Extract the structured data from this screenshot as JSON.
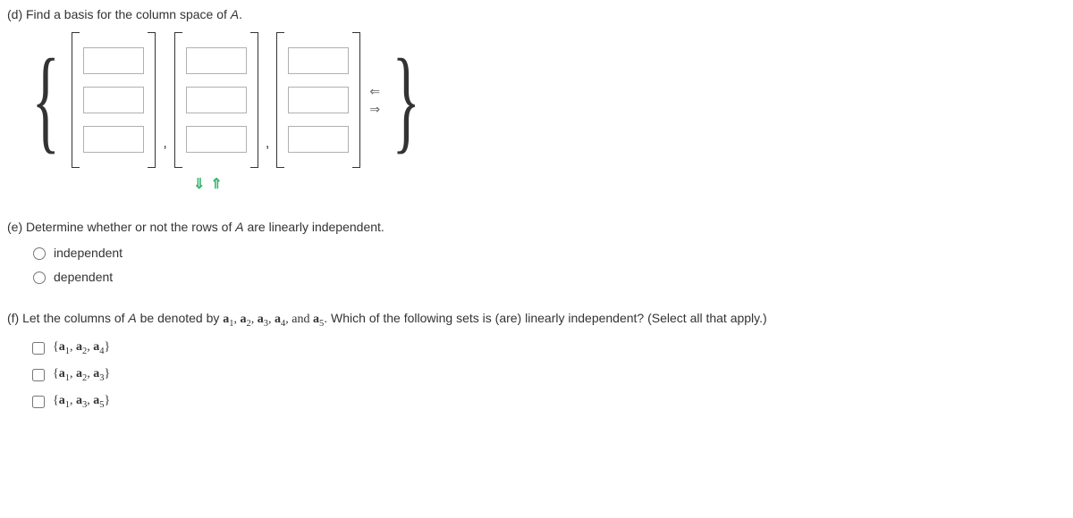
{
  "partD": {
    "label": "(d) Find a basis for the column space of ",
    "matrixVar": "A",
    "labelEnd": "."
  },
  "partE": {
    "label": "(e) Determine whether or not the rows of ",
    "matrixVar": "A",
    "labelEnd": " are linearly independent.",
    "options": [
      "independent",
      "dependent"
    ]
  },
  "partF": {
    "labelPrefix": "(f) Let the columns of ",
    "matrixVar": "A",
    "labelMid": " be denoted by ",
    "vectors": "a1, a2, a3, a4, and a5",
    "labelSuffix": ". Which of the following sets is (are) linearly independent? (Select all that apply.)",
    "options": [
      {
        "a": "1",
        "b": "2",
        "c": "4"
      },
      {
        "a": "1",
        "b": "2",
        "c": "3"
      },
      {
        "a": "1",
        "b": "3",
        "c": "5"
      }
    ]
  }
}
